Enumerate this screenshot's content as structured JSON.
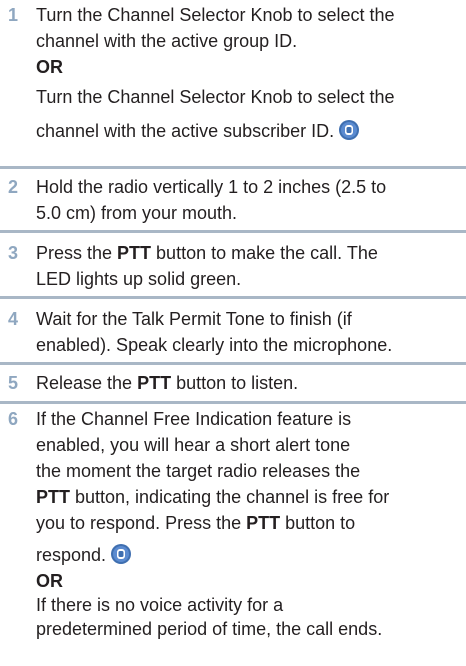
{
  "steps": [
    {
      "number": "1",
      "line1": "Turn the Channel Selector Knob to select the",
      "line2": "channel with the active group ID.",
      "or": "OR",
      "line3": "Turn the Channel Selector Knob to select the",
      "line4": "channel with the active subscriber ID."
    },
    {
      "number": "2",
      "line1": "Hold the radio vertically 1 to 2 inches (2.5 to",
      "line2": "5.0 cm) from your mouth."
    },
    {
      "number": "3",
      "pre": "Press the ",
      "bold": "PTT",
      "line1_post": " button to make the call. The",
      "line2": "LED lights up solid green."
    },
    {
      "number": "4",
      "line1": "Wait for the Talk Permit Tone to finish (if",
      "line2": "enabled). Speak clearly into the microphone."
    },
    {
      "number": "5",
      "pre": "Release the ",
      "bold": "PTT",
      "post": " button to listen."
    },
    {
      "number": "6",
      "line1": "If the Channel Free Indication feature is",
      "line2": "enabled, you will hear a short alert tone",
      "line3": "the moment the target radio releases the",
      "line4_bold": "PTT",
      "line4_post": " button, indicating the channel is free for",
      "line5_pre": "you to respond. Press the ",
      "line5_bold": "PTT",
      "line5_post": " button to",
      "line6": "respond.",
      "or": "OR",
      "line7": "If there is no voice activity for a",
      "line8": "predetermined period of time, the call ends."
    }
  ],
  "icons": {
    "feature_icon": "radio-feature-icon"
  },
  "colors": {
    "step_number": "#8fa7c0",
    "divider": "#a9b7c6",
    "icon_fill": "#3f6fb0",
    "text": "#231f20"
  }
}
